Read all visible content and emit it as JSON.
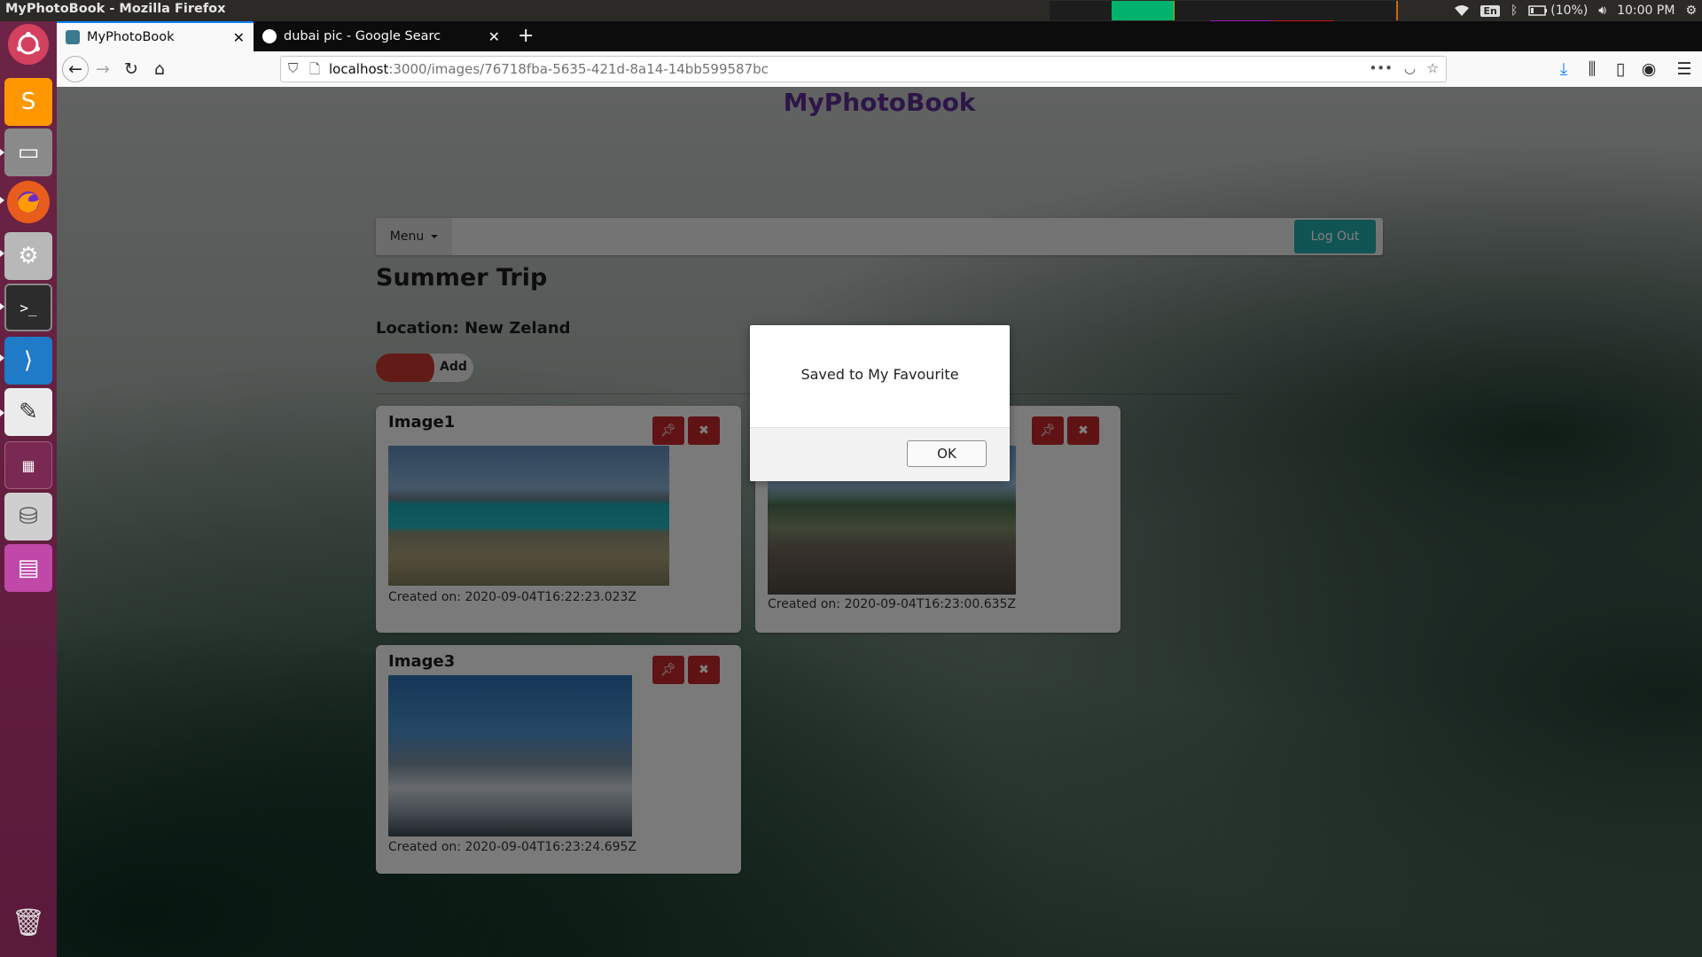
{
  "top_panel": {
    "window_title": "MyPhotoBook - Mozilla Firefox",
    "tray": {
      "language": "En",
      "battery": "(10%)",
      "time": "10:00 PM"
    }
  },
  "launcher": {
    "items": [
      "ubuntu-dash",
      "sublime-text",
      "files",
      "firefox",
      "system-settings",
      "terminal",
      "vscode",
      "text-editor",
      "workspace-switcher",
      "disks",
      "app-window",
      "trash"
    ]
  },
  "browser": {
    "tabs": [
      {
        "title": "MyPhotoBook",
        "active": true
      },
      {
        "title": "dubai pic - Google Searc",
        "active": false
      }
    ],
    "url_host": "localhost",
    "url_rest": ":3000/images/76718fba-5635-421d-8a14-14bb599587bc"
  },
  "page": {
    "brand": "MyPhotoBook",
    "menu_label": "Menu",
    "logout_label": "Log Out",
    "album_title": "Summer Trip",
    "location": "Location: New Zeland",
    "add_label": "Add",
    "images": [
      {
        "title": "Image1",
        "created": "Created on: 2020-09-04T16:22:23.023Z"
      },
      {
        "title": "",
        "created": "Created on: 2020-09-04T16:23:00.635Z"
      },
      {
        "title": "Image3",
        "created": "Created on: 2020-09-04T16:23:24.695Z"
      }
    ]
  },
  "modal": {
    "message": "Saved to My Favourite",
    "ok_label": "OK"
  },
  "colors": {
    "brand": "#5b2d8e",
    "logout": "#20a9a6",
    "danger": "#c0262b",
    "launcher": "#6d2446"
  }
}
